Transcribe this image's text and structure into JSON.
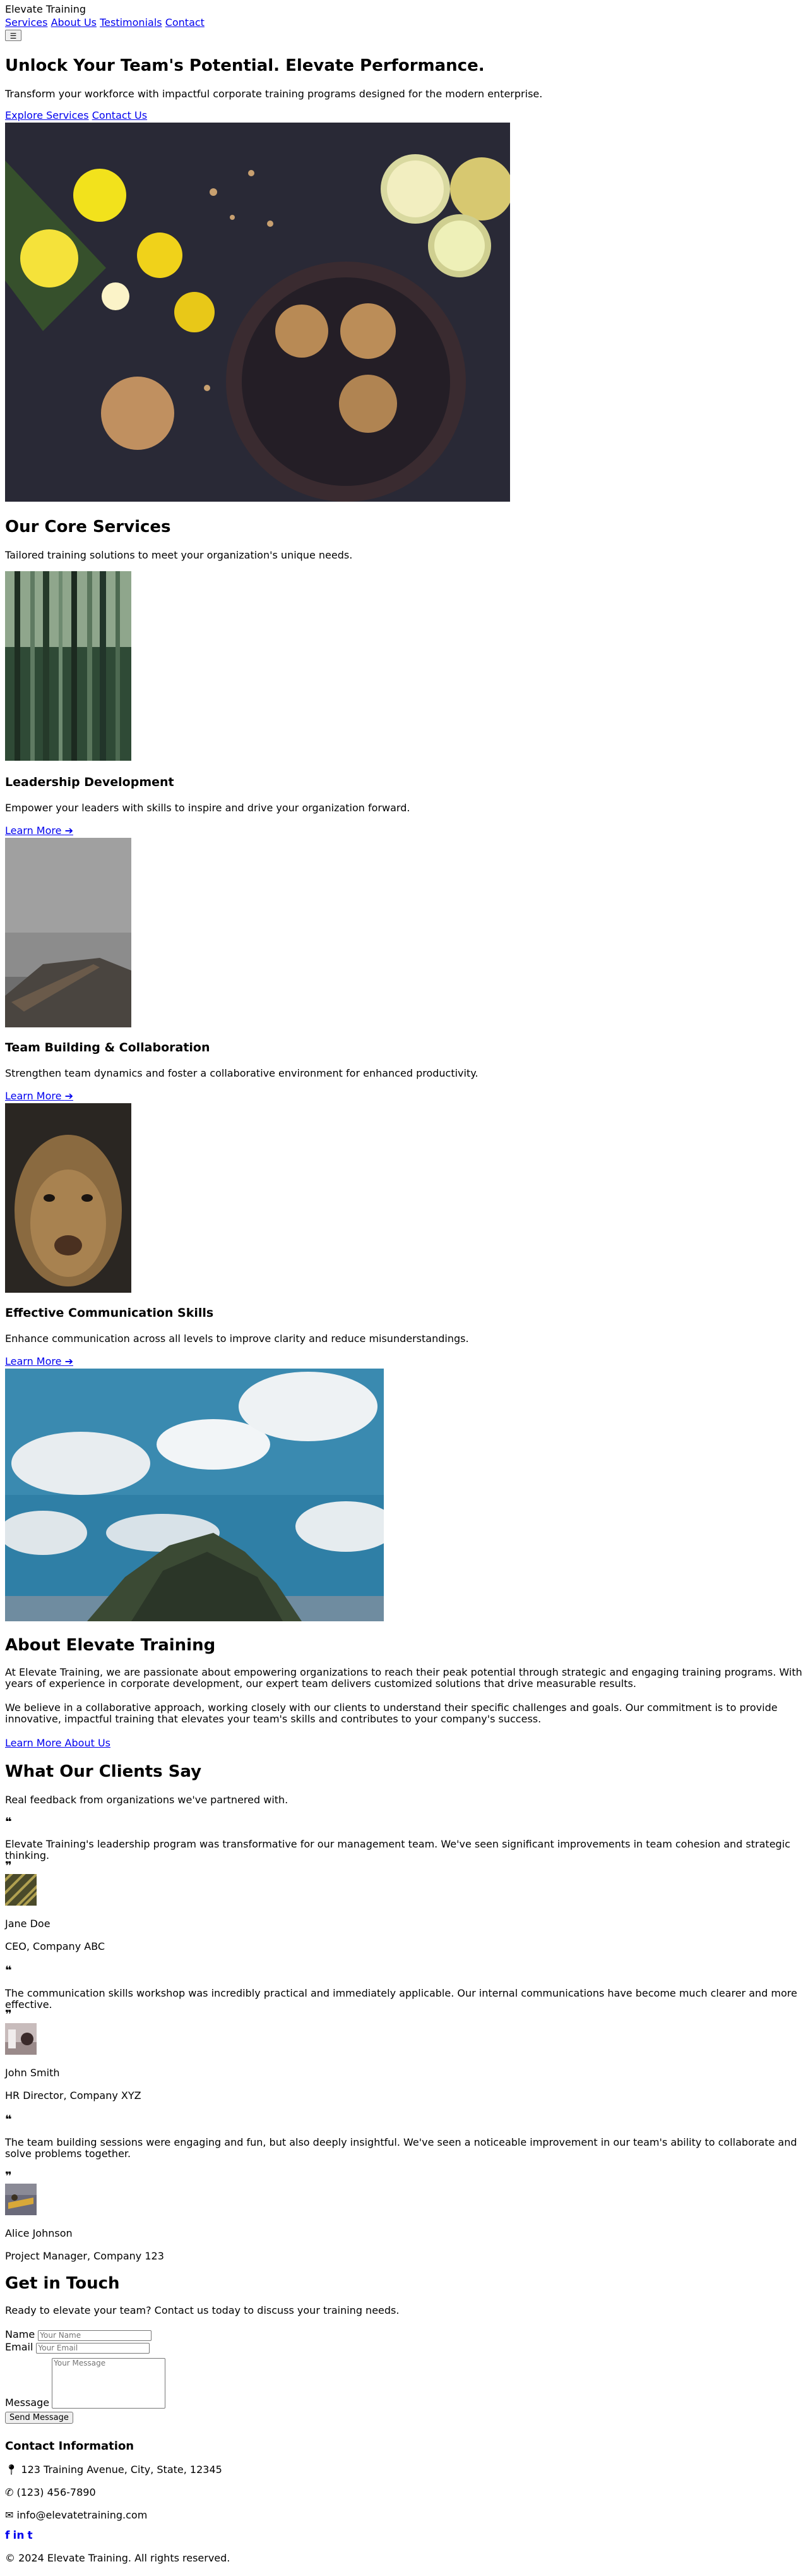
{
  "header": {
    "logo": "Elevate Training",
    "nav": [
      "Services",
      "About Us",
      "Testimonials",
      "Contact"
    ],
    "menu_icon": "hamburger-icon"
  },
  "hero": {
    "title": "Unlock Your Team's Potential. Elevate Performance.",
    "subtitle": "Transform your workforce with impactful corporate training programs designed for the modern enterprise.",
    "cta_primary": "Explore Services",
    "cta_secondary": "Contact Us"
  },
  "services": {
    "title": "Our Core Services",
    "subtitle": "Tailored training solutions to meet your organization's unique needs.",
    "items": [
      {
        "title": "Leadership Development",
        "description": "Empower your leaders with skills to inspire and drive your organization forward.",
        "link": "Learn More"
      },
      {
        "title": "Team Building & Collaboration",
        "description": "Strengthen team dynamics and foster a collaborative environment for enhanced productivity.",
        "link": "Learn More"
      },
      {
        "title": "Effective Communication Skills",
        "description": "Enhance communication across all levels to improve clarity and reduce misunderstandings.",
        "link": "Learn More"
      }
    ]
  },
  "about": {
    "title": "About Elevate Training",
    "p1": "At Elevate Training, we are passionate about empowering organizations to reach their peak potential through strategic and engaging training programs. With years of experience in corporate development, our expert team delivers customized solutions that drive measurable results.",
    "p2": "We believe in a collaborative approach, working closely with our clients to understand their specific challenges and goals. Our commitment is to provide innovative, impactful training that elevates your team's skills and contributes to your company's success.",
    "link": "Learn More About Us"
  },
  "testimonials": {
    "title": "What Our Clients Say",
    "subtitle": "Real feedback from organizations we've partnered with.",
    "items": [
      {
        "quote": "Elevate Training's leadership program was transformative for our management team. We've seen significant improvements in team cohesion and strategic thinking.",
        "name": "Jane Doe",
        "role": "CEO, Company ABC"
      },
      {
        "quote": "The communication skills workshop was incredibly practical and immediately applicable. Our internal communications have become much clearer and more effective.",
        "name": "John Smith",
        "role": "HR Director, Company XYZ"
      },
      {
        "quote": "The team building sessions were engaging and fun, but also deeply insightful. We've seen a noticeable improvement in our team's ability to collaborate and solve problems together.",
        "name": "Alice Johnson",
        "role": "Project Manager, Company 123"
      }
    ]
  },
  "contact": {
    "title": "Get in Touch",
    "subtitle": "Ready to elevate your team? Contact us today to discuss your training needs.",
    "name_label": "Name",
    "name_placeholder": "Your Name",
    "email_label": "Email",
    "email_placeholder": "Your Email",
    "message_label": "Message",
    "message_placeholder": "Your Message",
    "submit": "Send Message",
    "info_title": "Contact Information",
    "address": "123 Training Avenue, City, State, 12345",
    "phone": "(123) 456-7890",
    "email": "info@elevatetraining.com"
  },
  "footer": {
    "social": [
      "f",
      "in",
      "t"
    ],
    "copyright": "© 2024 Elevate Training. All rights reserved."
  }
}
